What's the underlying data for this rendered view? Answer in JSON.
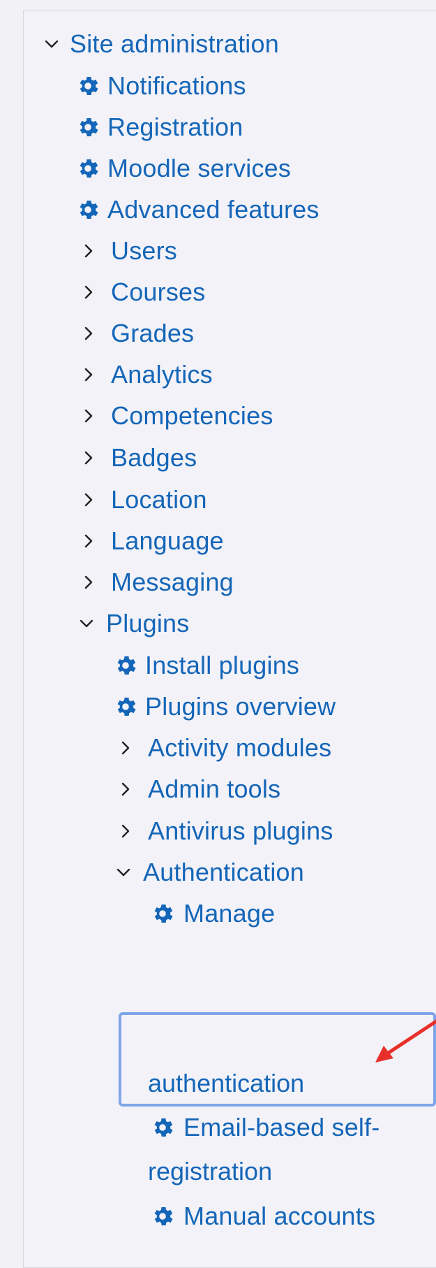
{
  "tree": {
    "root": {
      "label": "Site administration",
      "expanded": true
    },
    "root_children": [
      {
        "label": "Notifications",
        "type": "page"
      },
      {
        "label": "Registration",
        "type": "page"
      },
      {
        "label": "Moodle services",
        "type": "page"
      },
      {
        "label": "Advanced features",
        "type": "page"
      },
      {
        "label": "Users",
        "type": "category",
        "expanded": false
      },
      {
        "label": "Courses",
        "type": "category",
        "expanded": false
      },
      {
        "label": "Grades",
        "type": "category",
        "expanded": false
      },
      {
        "label": "Analytics",
        "type": "category",
        "expanded": false
      },
      {
        "label": "Competencies",
        "type": "category",
        "expanded": false
      },
      {
        "label": "Badges",
        "type": "category",
        "expanded": false
      },
      {
        "label": "Location",
        "type": "category",
        "expanded": false
      },
      {
        "label": "Language",
        "type": "category",
        "expanded": false
      },
      {
        "label": "Messaging",
        "type": "category",
        "expanded": false
      },
      {
        "label": "Plugins",
        "type": "category",
        "expanded": true
      }
    ],
    "plugins_children": [
      {
        "label": "Install plugins",
        "type": "page"
      },
      {
        "label": "Plugins overview",
        "type": "page"
      },
      {
        "label": "Activity modules",
        "type": "category",
        "expanded": false
      },
      {
        "label": "Admin tools",
        "type": "category",
        "expanded": false
      },
      {
        "label": "Antivirus plugins",
        "type": "category",
        "expanded": false
      },
      {
        "label": "Authentication",
        "type": "category",
        "expanded": true
      }
    ],
    "authentication_children": [
      {
        "label_line1": "Manage",
        "label_line2": "authentication",
        "type": "page",
        "selected": true
      },
      {
        "label_line1": "Email-based self-",
        "label_line2": "registration",
        "type": "page"
      },
      {
        "label": "Manual accounts",
        "type": "page"
      }
    ]
  },
  "colors": {
    "link": "#1466b8",
    "highlight": "#7fa5e8",
    "annotation_arrow": "#e8302a"
  },
  "icons": {
    "page": "gear-icon",
    "collapsed": "chevron-right-icon",
    "expanded": "chevron-down-icon",
    "annotation": "red-arrow"
  }
}
